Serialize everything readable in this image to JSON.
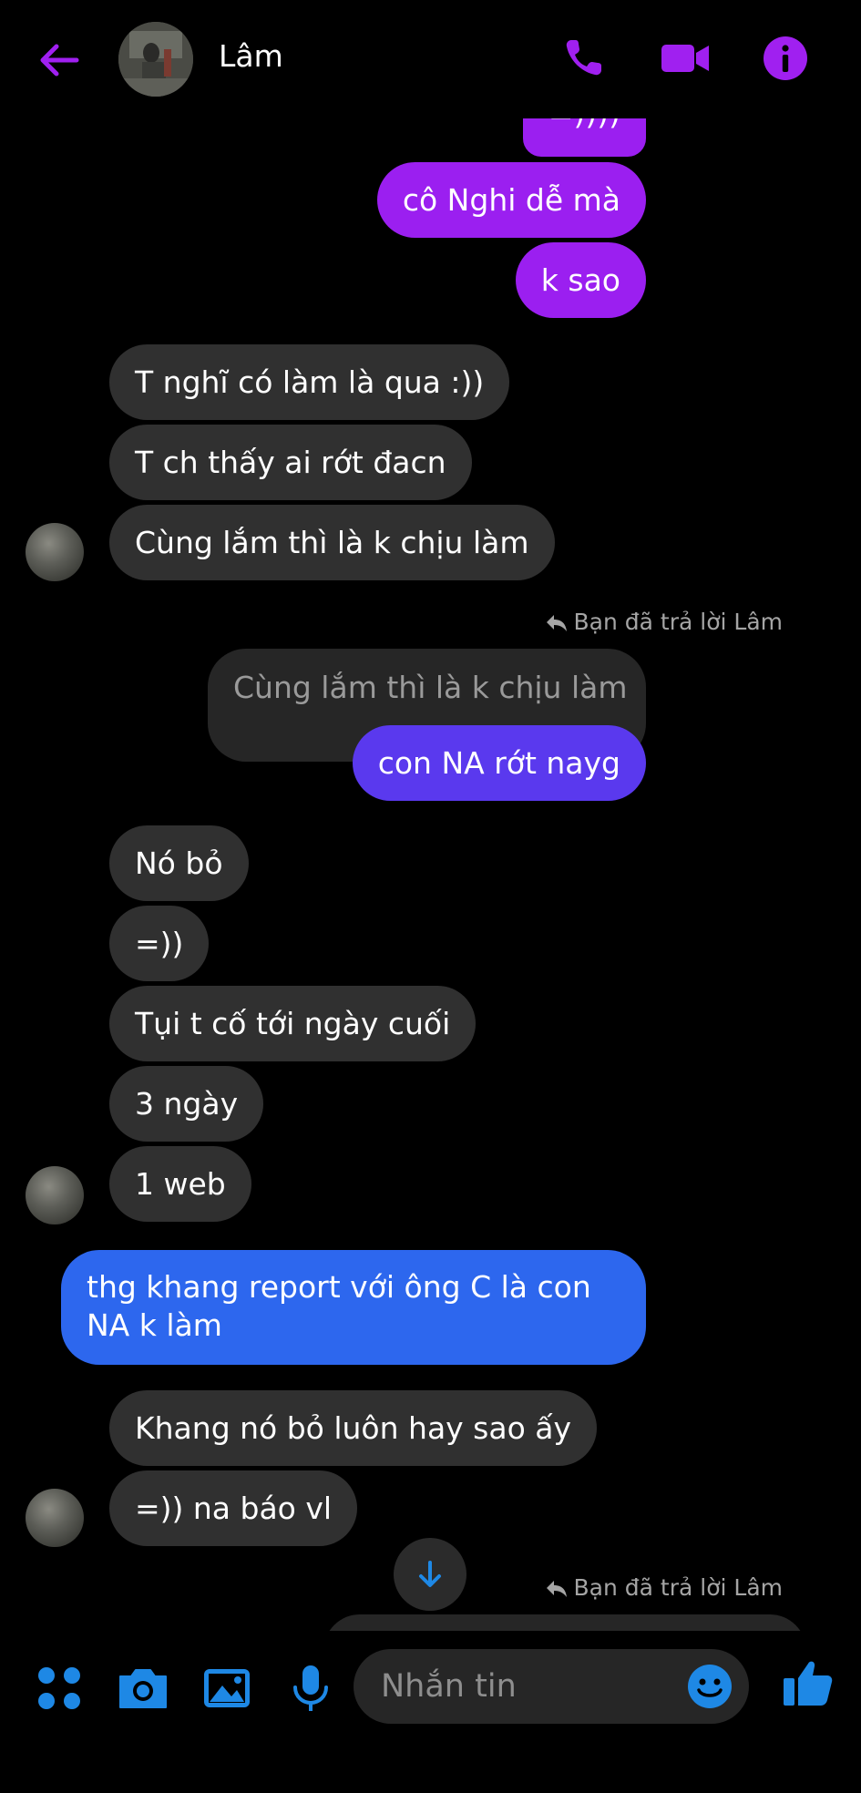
{
  "header": {
    "contact_name": "Lâm",
    "back_icon": "arrow-left-icon",
    "call_icon": "phone-icon",
    "video_icon": "video-camera-icon",
    "info_icon": "info-icon"
  },
  "messages": [
    {
      "from": "me",
      "text": "=))))"
    },
    {
      "from": "me",
      "text": "cô Nghi dễ mà"
    },
    {
      "from": "me",
      "text": "k sao"
    },
    {
      "from": "them",
      "text": "T nghĩ có làm là qua :))"
    },
    {
      "from": "them",
      "text": "T ch thấy ai rớt đacn"
    },
    {
      "from": "them",
      "text": "Cùng lắm thì là k chịu làm"
    },
    {
      "reply_note": "Bạn đã trả lời Lâm",
      "quoted": "Cùng lắm thì là k chịu làm"
    },
    {
      "from": "me",
      "text": "con NA rớt nayg"
    },
    {
      "from": "them",
      "text": "Nó bỏ"
    },
    {
      "from": "them",
      "text": "=))"
    },
    {
      "from": "them",
      "text": "Tụi t cố tới ngày cuối"
    },
    {
      "from": "them",
      "text": "3 ngày"
    },
    {
      "from": "them",
      "text": "1 web"
    },
    {
      "from": "me",
      "text_line1": "thg khang report với ông C là con",
      "text_line2": "NA k làm"
    },
    {
      "from": "them",
      "text": "Khang nó bỏ luôn hay sao ấy"
    },
    {
      "from": "them",
      "text": "=)) na báo vl"
    },
    {
      "reply_note": "Bạn đã trả lời Lâm"
    }
  ],
  "composer": {
    "placeholder": "Nhắn tin",
    "icons": [
      "apps-icon",
      "camera-icon",
      "gallery-icon",
      "microphone-icon",
      "emoji-icon",
      "thumbs-up-icon"
    ]
  },
  "colors": {
    "accent_purple": "#9b1ff0",
    "gradient_mid": "#5a39ee",
    "gradient_blue": "#2d67ee",
    "composer_blue": "#1e88e5",
    "bubble_incoming": "#303030"
  }
}
